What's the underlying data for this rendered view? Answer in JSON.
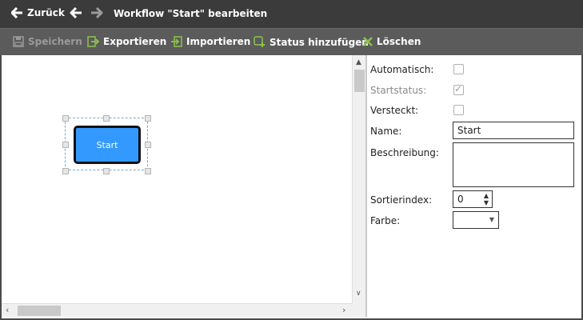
{
  "header": {
    "back_label": "Zurück",
    "title": "Workflow \"Start\" bearbeiten"
  },
  "toolbar": {
    "save_label": "Speichern",
    "export_label": "Exportieren",
    "import_label": "Importieren",
    "add_status_label": "Status hinzufügen",
    "delete_label": "Löschen"
  },
  "canvas": {
    "node_label": "Start"
  },
  "properties": {
    "automatic_label": "Automatisch:",
    "automatic_checked": false,
    "start_status_label": "Startstatus:",
    "start_status_checked": true,
    "hidden_label": "Versteckt:",
    "hidden_checked": false,
    "name_label": "Name:",
    "name_value": "Start",
    "description_label": "Beschreibung:",
    "description_value": "",
    "sort_index_label": "Sortierindex:",
    "sort_index_value": "0",
    "color_label": "Farbe:",
    "color_value": ""
  },
  "colors": {
    "titlebar": "#3b3b3b",
    "toolbar": "#5b5b5b",
    "node_fill": "#3399ff",
    "icon_green": "#8bc34a"
  }
}
